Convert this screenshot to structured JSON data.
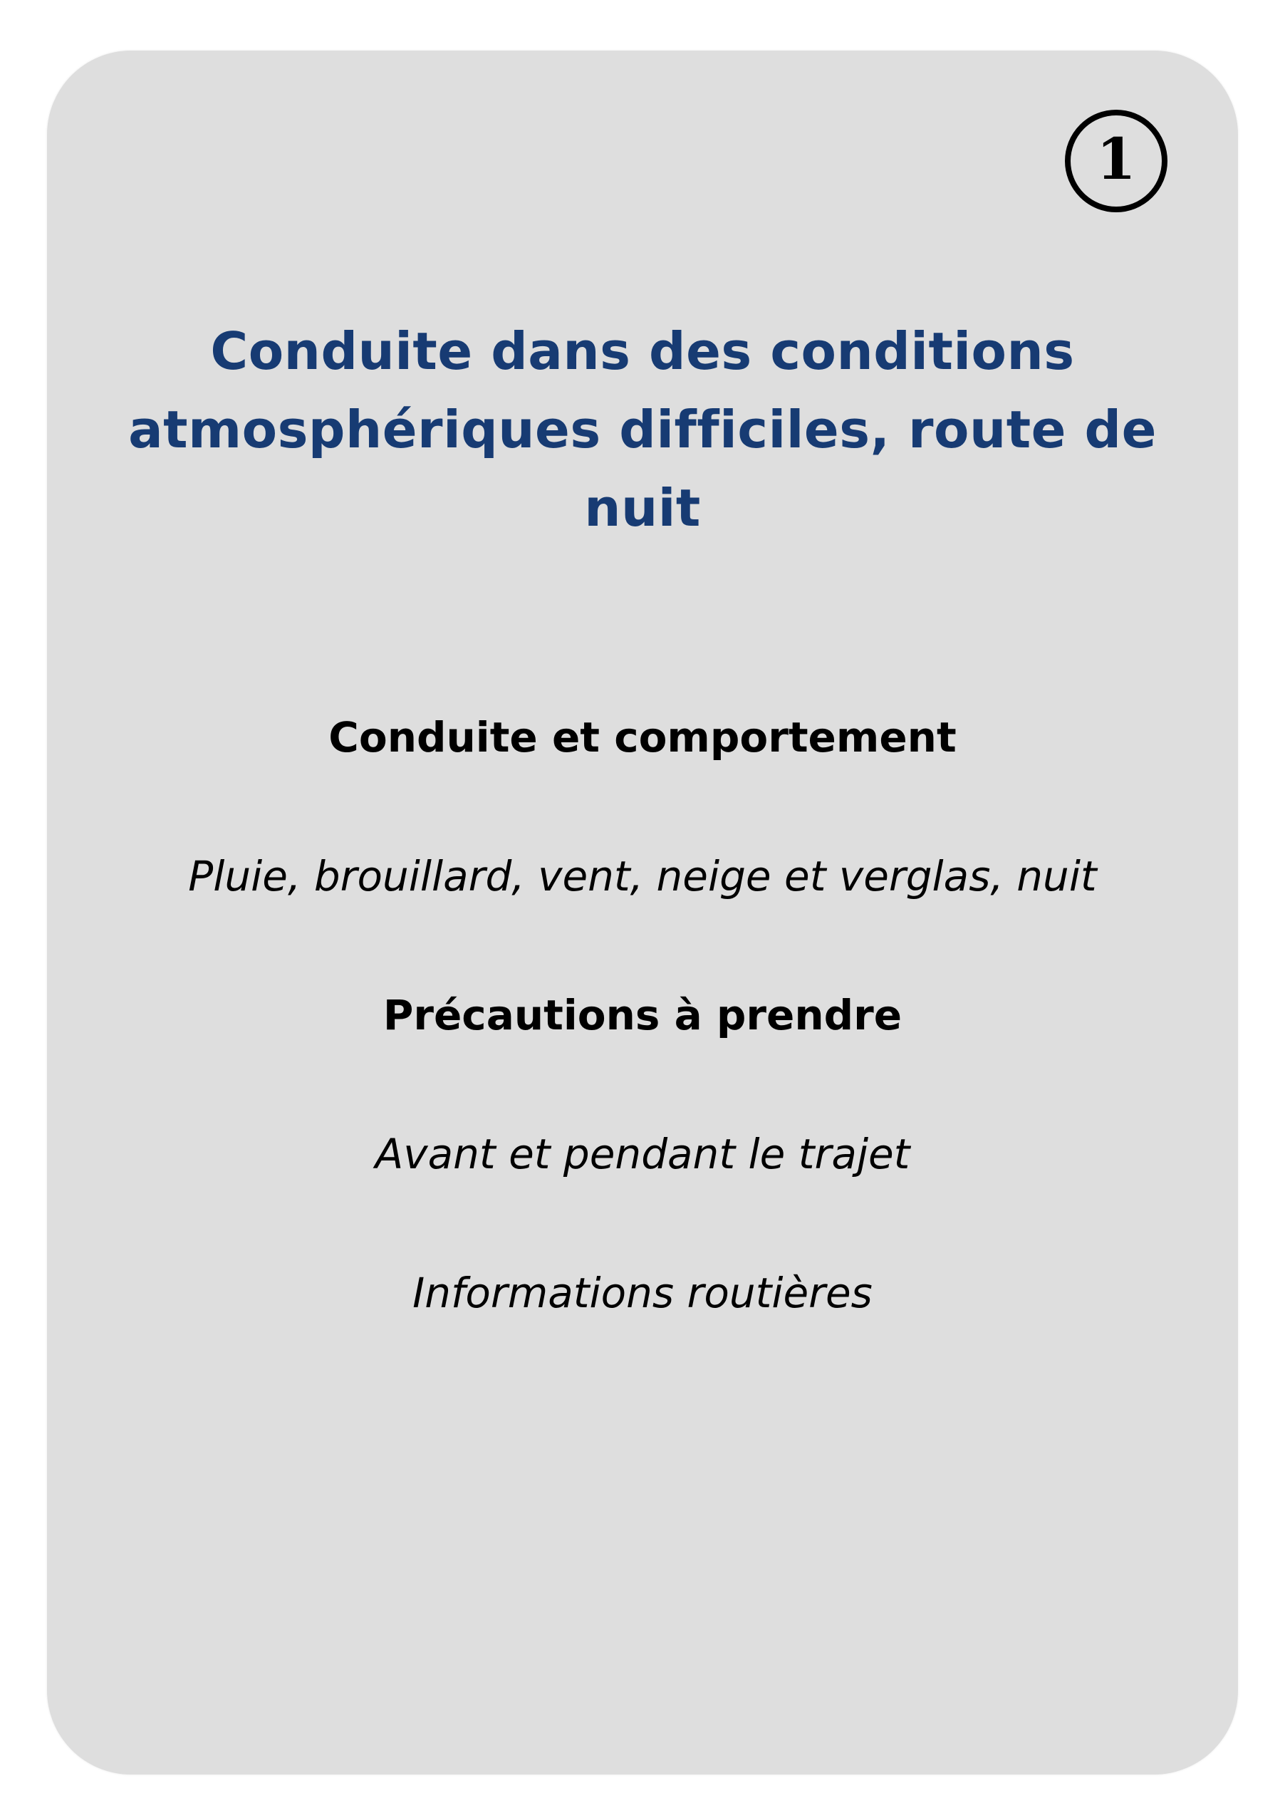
{
  "card": {
    "number": "1",
    "title": "Conduite dans des conditions atmosphériques difficiles, route de nuit",
    "lines": [
      {
        "text": "Conduite et comportement",
        "style": "bold"
      },
      {
        "text": "Pluie, brouillard, vent, neige et verglas, nuit",
        "style": "italic"
      },
      {
        "text": "Précautions à prendre",
        "style": "bold"
      },
      {
        "text": "Avant et pendant le trajet",
        "style": "italic"
      },
      {
        "text": "Informations routières",
        "style": "italic"
      }
    ]
  },
  "colors": {
    "card_background": "#dedede",
    "title": "#173b73",
    "text": "#000000",
    "page_background": "#ffffff"
  }
}
